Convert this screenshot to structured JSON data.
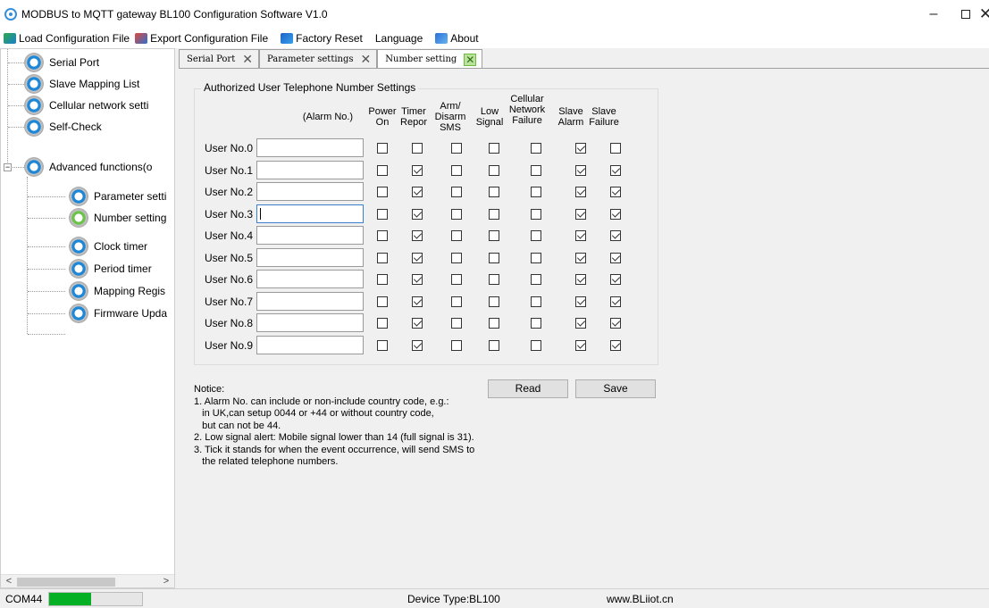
{
  "window": {
    "title": "MODBUS to MQTT gateway BL100 Configuration Software V1.0",
    "min_glyph": "–",
    "close_glyph": "✕"
  },
  "menu": [
    {
      "label": "Load Configuration File",
      "icon": "load-file-icon"
    },
    {
      "label": "Export Configuration File",
      "icon": "export-file-icon"
    },
    {
      "label": "Factory Reset",
      "icon": "factory-reset-icon"
    },
    {
      "label": "Language",
      "icon": ""
    },
    {
      "label": "About",
      "icon": "about-icon"
    }
  ],
  "tree": {
    "items": [
      {
        "label": "Serial Port"
      },
      {
        "label": "Slave Mapping List"
      },
      {
        "label": "Cellular network setti"
      },
      {
        "label": "Self-Check"
      },
      {
        "label": "Advanced functions(o"
      },
      {
        "label": "Parameter setti"
      },
      {
        "label": "Number setting"
      },
      {
        "label": "Clock timer"
      },
      {
        "label": "Period timer"
      },
      {
        "label": "Mapping Regis"
      },
      {
        "label": "Firmware Upda"
      }
    ],
    "expander_glyph": "−",
    "scroll_left": "<",
    "scroll_right": ">"
  },
  "tabs": [
    {
      "label": "Serial Port"
    },
    {
      "label": "Parameter settings"
    },
    {
      "label": "Number setting"
    }
  ],
  "tab_close_glyph": "✕",
  "group": {
    "title": "Authorized User Telephone Number Settings",
    "columns": {
      "alarm_no": "(Alarm No.)",
      "power_on": "Power On",
      "timer_report": "Timer Repor",
      "arm_disarm": "Arm/ Disarm SMS",
      "low_signal": "Low Signal",
      "cellular_failure": "Cellular Network Failure",
      "slave_alarm": "Slave Alarm",
      "slave_failure": "Slave Failure"
    },
    "users": [
      {
        "label": "User No.0",
        "number": "",
        "checks": [
          false,
          false,
          false,
          false,
          false,
          true,
          false
        ]
      },
      {
        "label": "User No.1",
        "number": "",
        "checks": [
          false,
          true,
          false,
          false,
          false,
          true,
          true
        ]
      },
      {
        "label": "User No.2",
        "number": "",
        "checks": [
          false,
          true,
          false,
          false,
          false,
          true,
          true
        ]
      },
      {
        "label": "User No.3",
        "number": "",
        "checks": [
          false,
          true,
          false,
          false,
          false,
          true,
          true
        ]
      },
      {
        "label": "User No.4",
        "number": "",
        "checks": [
          false,
          true,
          false,
          false,
          false,
          true,
          true
        ]
      },
      {
        "label": "User No.5",
        "number": "",
        "checks": [
          false,
          true,
          false,
          false,
          false,
          true,
          true
        ]
      },
      {
        "label": "User No.6",
        "number": "",
        "checks": [
          false,
          true,
          false,
          false,
          false,
          true,
          true
        ]
      },
      {
        "label": "User No.7",
        "number": "",
        "checks": [
          false,
          true,
          false,
          false,
          false,
          true,
          true
        ]
      },
      {
        "label": "User No.8",
        "number": "",
        "checks": [
          false,
          true,
          false,
          false,
          false,
          true,
          true
        ]
      },
      {
        "label": "User No.9",
        "number": "",
        "checks": [
          false,
          true,
          false,
          false,
          false,
          true,
          true
        ]
      }
    ]
  },
  "buttons": {
    "read": "Read",
    "save": "Save"
  },
  "notice": {
    "title": "Notice:",
    "lines": [
      "1. Alarm No. can include or non-include country code, e.g.:",
      "   in UK,can setup 0044 or +44 or without country code,",
      "   but can not be 44.",
      "2. Low signal alert: Mobile signal lower than 14 (full signal is 31).",
      "3. Tick it stands for when the event occurrence, will send SMS to",
      "   the related telephone numbers."
    ]
  },
  "status": {
    "port": "COM44",
    "progress": 0.45,
    "device_type": "Device Type:BL100",
    "website": "www.BLiiot.cn",
    "progress_color": "#06b025"
  }
}
